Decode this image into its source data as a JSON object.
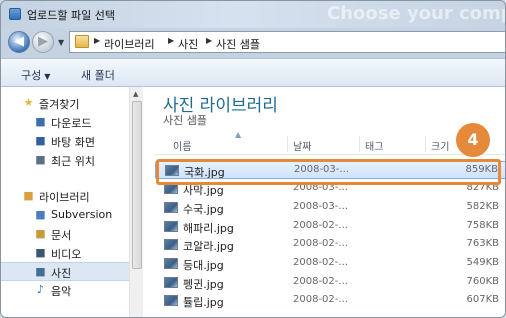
{
  "window": {
    "title": "업로드할 파일 선택",
    "background_text": "Choose your comp"
  },
  "nav": {
    "back_glyph": "◀",
    "forward_glyph": "▶",
    "dropdown_glyph": "▼",
    "breadcrumb": [
      "라이브러리",
      "사진",
      "사진 샘플"
    ],
    "separator_glyph": "▶"
  },
  "toolbar": {
    "organize_label": "구성",
    "organize_caret": "▼",
    "new_folder_label": "새 폴더"
  },
  "sidebar": {
    "items": [
      {
        "label": "즐겨찾기",
        "icon": "star-icon",
        "glyph": "★",
        "color": "#e8b53a"
      },
      {
        "label": "다운로드",
        "icon": "download-folder-icon",
        "glyph": "■",
        "color": "#3b6fb0"
      },
      {
        "label": "바탕 화면",
        "icon": "desktop-icon",
        "glyph": "■",
        "color": "#2f5f9e"
      },
      {
        "label": "최근 위치",
        "icon": "recent-places-icon",
        "glyph": "■",
        "color": "#5b6f86"
      },
      {
        "label": "라이브러리",
        "icon": "libraries-icon",
        "glyph": "■",
        "color": "#d6a13e"
      },
      {
        "label": "Subversion",
        "icon": "subversion-library-icon",
        "glyph": "■",
        "color": "#4a7dbf"
      },
      {
        "label": "문서",
        "icon": "documents-icon",
        "glyph": "■",
        "color": "#c79a3c"
      },
      {
        "label": "비디오",
        "icon": "videos-icon",
        "glyph": "■",
        "color": "#3c5676"
      },
      {
        "label": "사진",
        "icon": "pictures-icon",
        "glyph": "■",
        "color": "#3f6e96"
      },
      {
        "label": "음악",
        "icon": "music-icon",
        "glyph": "♪",
        "color": "#2f6fc2"
      }
    ],
    "selected_index": 8
  },
  "main": {
    "library_title": "사진 라이브러리",
    "library_subtitle": "사진 샘플",
    "columns": {
      "name": "이름",
      "date": "날짜",
      "tags": "태그",
      "size": "크기"
    },
    "files": [
      {
        "name": "국화.jpg",
        "date": "2008-03-...",
        "size": "859KB"
      },
      {
        "name": "사막.jpg",
        "date": "2008-03-...",
        "size": "827KB"
      },
      {
        "name": "수국.jpg",
        "date": "2008-03-...",
        "size": "582KB"
      },
      {
        "name": "해파리.jpg",
        "date": "2008-02-...",
        "size": "758KB"
      },
      {
        "name": "코알라.jpg",
        "date": "2008-02-...",
        "size": "763KB"
      },
      {
        "name": "등대.jpg",
        "date": "2008-02-...",
        "size": "549KB"
      },
      {
        "name": "펭귄.jpg",
        "date": "2008-02-...",
        "size": "760KB"
      },
      {
        "name": "튤립.jpg",
        "date": "2008-02-...",
        "size": "607KB"
      }
    ],
    "selected_file_index": 0
  },
  "annotation": {
    "step_number": "4",
    "accent_color": "#e5893a"
  }
}
